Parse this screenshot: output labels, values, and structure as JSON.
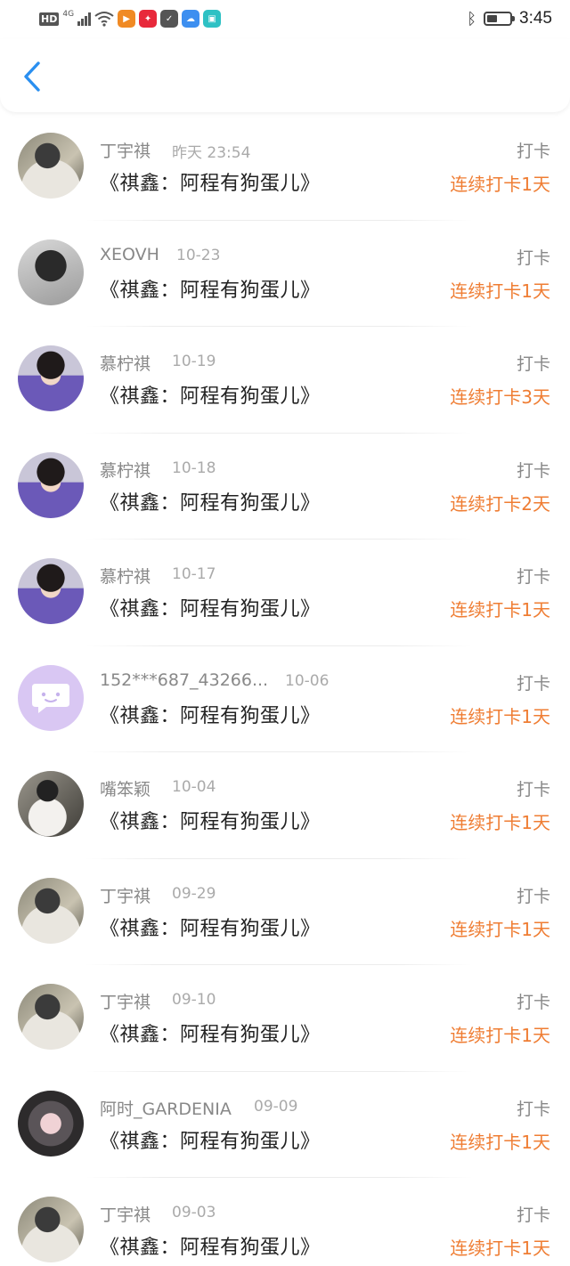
{
  "status_bar": {
    "hd": "HD",
    "network": "4G",
    "time": "3:45",
    "battery_level": 0.45,
    "app_icons": [
      {
        "name": "video-app-icon",
        "color": "#f08a24",
        "glyph": "▶"
      },
      {
        "name": "red-app-icon",
        "color": "#e8293b",
        "glyph": "✦"
      },
      {
        "name": "shield-app-icon",
        "color": "#555555",
        "glyph": "✓"
      },
      {
        "name": "cloud-app-icon",
        "color": "#3d8ff0",
        "glyph": "☁"
      },
      {
        "name": "book-app-icon",
        "color": "#2ec1c4",
        "glyph": "▣"
      }
    ]
  },
  "nav": {
    "back_icon": "chevron-left-icon",
    "accent_color": "#2a8ff0"
  },
  "colors": {
    "streak": "#ef7d33",
    "name": "#888888",
    "title": "#222222"
  },
  "items": [
    {
      "user": "丁宇祺",
      "time": "昨天 23:54",
      "title": "《祺鑫：阿程有狗蛋儿》",
      "tag": "打卡",
      "streak": "连续打卡1天",
      "avatar": "av-a"
    },
    {
      "user": "XEOVH",
      "time": "10-23",
      "title": "《祺鑫：阿程有狗蛋儿》",
      "tag": "打卡",
      "streak": "连续打卡1天",
      "avatar": "av-b"
    },
    {
      "user": "慕柠祺",
      "time": "10-19",
      "title": "《祺鑫：阿程有狗蛋儿》",
      "tag": "打卡",
      "streak": "连续打卡3天",
      "avatar": "av-c"
    },
    {
      "user": "慕柠祺",
      "time": "10-18",
      "title": "《祺鑫：阿程有狗蛋儿》",
      "tag": "打卡",
      "streak": "连续打卡2天",
      "avatar": "av-c"
    },
    {
      "user": "慕柠祺",
      "time": "10-17",
      "title": "《祺鑫：阿程有狗蛋儿》",
      "tag": "打卡",
      "streak": "连续打卡1天",
      "avatar": "av-c"
    },
    {
      "user": "152***687_43266...",
      "time": "10-06",
      "title": "《祺鑫：阿程有狗蛋儿》",
      "tag": "打卡",
      "streak": "连续打卡1天",
      "avatar": "av-d"
    },
    {
      "user": "嘴笨颖",
      "time": "10-04",
      "title": "《祺鑫：阿程有狗蛋儿》",
      "tag": "打卡",
      "streak": "连续打卡1天",
      "avatar": "av-e"
    },
    {
      "user": "丁宇祺",
      "time": "09-29",
      "title": "《祺鑫：阿程有狗蛋儿》",
      "tag": "打卡",
      "streak": "连续打卡1天",
      "avatar": "av-a"
    },
    {
      "user": "丁宇祺",
      "time": "09-10",
      "title": "《祺鑫：阿程有狗蛋儿》",
      "tag": "打卡",
      "streak": "连续打卡1天",
      "avatar": "av-a"
    },
    {
      "user": "阿时_GARDENIA",
      "time": "09-09",
      "title": "《祺鑫：阿程有狗蛋儿》",
      "tag": "打卡",
      "streak": "连续打卡1天",
      "avatar": "av-f"
    },
    {
      "user": "丁宇祺",
      "time": "09-03",
      "title": "《祺鑫：阿程有狗蛋儿》",
      "tag": "打卡",
      "streak": "连续打卡1天",
      "avatar": "av-a"
    }
  ]
}
